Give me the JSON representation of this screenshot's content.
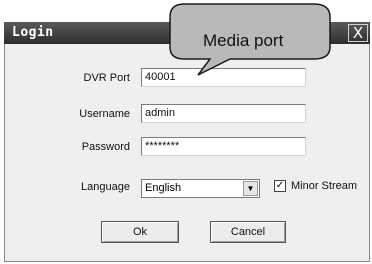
{
  "window": {
    "title": "Login",
    "close_symbol": "X"
  },
  "form": {
    "dvr_port_label": "DVR Port",
    "dvr_port_value": "40001",
    "username_label": "Username",
    "username_value": "admin",
    "password_label": "Password",
    "password_value": "********",
    "language_label": "Language",
    "language_value": "English",
    "minor_stream_label": "Minor Stream",
    "minor_stream_checked": true
  },
  "buttons": {
    "ok": "Ok",
    "cancel": "Cancel"
  },
  "callout": {
    "text": "Media port"
  },
  "icons": {
    "dropdown": "chevron-down-icon",
    "check": "check-icon",
    "close": "close-icon"
  }
}
